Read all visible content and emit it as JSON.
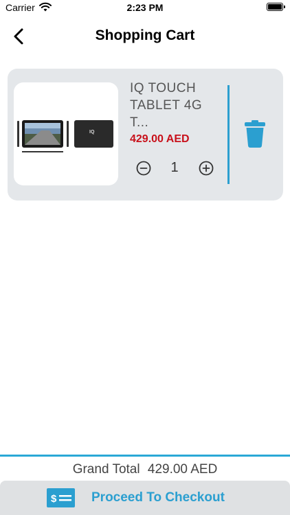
{
  "status_bar": {
    "carrier": "Carrier",
    "time": "2:23 PM"
  },
  "header": {
    "title": "Shopping Cart",
    "back_icon": "chevron-left-icon"
  },
  "cart": {
    "items": [
      {
        "name": "IQ TOUCH TABLET 4G T...",
        "price": "429.00 AED",
        "quantity": "1",
        "image": "tablet-product-image"
      }
    ]
  },
  "summary": {
    "grand_total_label": "Grand Total",
    "grand_total_value": "429.00 AED"
  },
  "checkout": {
    "label": "Proceed To Checkout",
    "icon": "payment-card-icon"
  },
  "colors": {
    "accent": "#2b9fd0",
    "price": "#c8101a",
    "card_background": "#e4e7ea"
  }
}
